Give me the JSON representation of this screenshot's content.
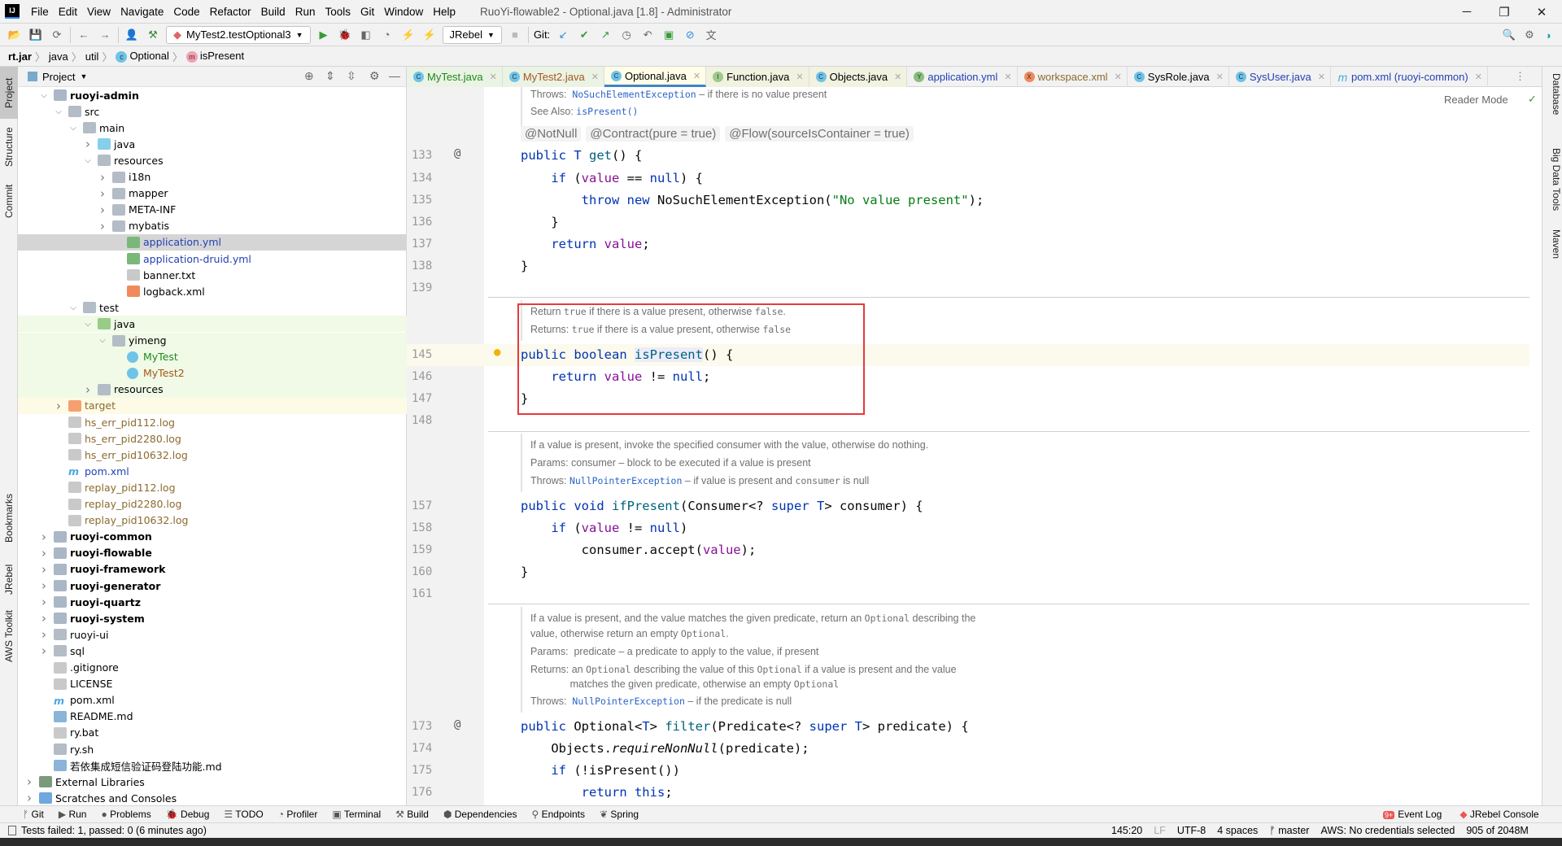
{
  "window": {
    "title": "RuoYi-flowable2 - Optional.java [1.8] - Administrator",
    "logo": "IJ"
  },
  "menu": [
    "File",
    "Edit",
    "View",
    "Navigate",
    "Code",
    "Refactor",
    "Build",
    "Run",
    "Tools",
    "Git",
    "Window",
    "Help"
  ],
  "toolbar": {
    "run_config": "MyTest2.testOptional3",
    "jrebel": "JRebel",
    "git_label": "Git:"
  },
  "breadcrumb": [
    "rt.jar",
    "java",
    "util",
    "Optional",
    "isPresent"
  ],
  "left_stripe": [
    "Project",
    "Structure",
    "Commit",
    "Bookmarks",
    "JRebel",
    "AWS Toolkit"
  ],
  "right_stripe": [
    "Database",
    "Big Data Tools",
    "Maven"
  ],
  "project": {
    "title": "Project",
    "tree": [
      {
        "label": "ruoyi-admin",
        "depth": 0,
        "arrow": "open",
        "icon": "module",
        "bold": true
      },
      {
        "label": "src",
        "depth": 1,
        "arrow": "open",
        "icon": "folder"
      },
      {
        "label": "main",
        "depth": 2,
        "arrow": "open",
        "icon": "folder"
      },
      {
        "label": "java",
        "depth": 3,
        "arrow": "closed",
        "icon": "src-folder"
      },
      {
        "label": "resources",
        "depth": 3,
        "arrow": "open",
        "icon": "res-folder"
      },
      {
        "label": "i18n",
        "depth": 4,
        "arrow": "closed",
        "icon": "folder"
      },
      {
        "label": "mapper",
        "depth": 4,
        "arrow": "closed",
        "icon": "folder"
      },
      {
        "label": "META-INF",
        "depth": 4,
        "arrow": "closed",
        "icon": "folder"
      },
      {
        "label": "mybatis",
        "depth": 4,
        "arrow": "closed",
        "icon": "folder"
      },
      {
        "label": "application.yml",
        "depth": 5,
        "icon": "yml",
        "color": "#2341b4",
        "bg": "#d5d5d5"
      },
      {
        "label": "application-druid.yml",
        "depth": 5,
        "icon": "yml",
        "color": "#2341b4"
      },
      {
        "label": "banner.txt",
        "depth": 5,
        "icon": "file"
      },
      {
        "label": "logback.xml",
        "depth": 5,
        "icon": "xml"
      },
      {
        "label": "test",
        "depth": 2,
        "arrow": "open",
        "icon": "folder"
      },
      {
        "label": "java",
        "depth": 3,
        "arrow": "open",
        "icon": "test-folder",
        "bg": "#f0fae6"
      },
      {
        "label": "yimeng",
        "depth": 4,
        "arrow": "open",
        "icon": "package",
        "bg": "#f0fae6"
      },
      {
        "label": "MyTest",
        "depth": 5,
        "icon": "class",
        "color": "#20891f",
        "bg": "#f0fae6"
      },
      {
        "label": "MyTest2",
        "depth": 5,
        "icon": "class",
        "color": "#a5571a",
        "bg": "#f0fae6"
      },
      {
        "label": "resources",
        "depth": 3,
        "arrow": "closed",
        "icon": "res-folder",
        "bg": "#f0fae6"
      },
      {
        "label": "target",
        "depth": 1,
        "arrow": "closed",
        "icon": "excluded",
        "color": "#8c6a2e",
        "bg": "#fdfbe6"
      },
      {
        "label": "hs_err_pid112.log",
        "depth": 1,
        "icon": "file",
        "color": "#8c6a2e"
      },
      {
        "label": "hs_err_pid2280.log",
        "depth": 1,
        "icon": "file",
        "color": "#8c6a2e"
      },
      {
        "label": "hs_err_pid10632.log",
        "depth": 1,
        "icon": "file",
        "color": "#8c6a2e"
      },
      {
        "label": "pom.xml",
        "depth": 1,
        "icon": "maven",
        "color": "#2341b4"
      },
      {
        "label": "replay_pid112.log",
        "depth": 1,
        "icon": "file",
        "color": "#8c6a2e"
      },
      {
        "label": "replay_pid2280.log",
        "depth": 1,
        "icon": "file",
        "color": "#8c6a2e"
      },
      {
        "label": "replay_pid10632.log",
        "depth": 1,
        "icon": "file",
        "color": "#8c6a2e"
      },
      {
        "label": "ruoyi-common",
        "depth": 0,
        "arrow": "closed",
        "icon": "module",
        "bold": true
      },
      {
        "label": "ruoyi-flowable",
        "depth": 0,
        "arrow": "closed",
        "icon": "module",
        "bold": true
      },
      {
        "label": "ruoyi-framework",
        "depth": 0,
        "arrow": "closed",
        "icon": "module",
        "bold": true
      },
      {
        "label": "ruoyi-generator",
        "depth": 0,
        "arrow": "closed",
        "icon": "module",
        "bold": true
      },
      {
        "label": "ruoyi-quartz",
        "depth": 0,
        "arrow": "closed",
        "icon": "module",
        "bold": true
      },
      {
        "label": "ruoyi-system",
        "depth": 0,
        "arrow": "closed",
        "icon": "module",
        "bold": true
      },
      {
        "label": "ruoyi-ui",
        "depth": 0,
        "arrow": "closed",
        "icon": "folder"
      },
      {
        "label": "sql",
        "depth": 0,
        "arrow": "closed",
        "icon": "folder"
      },
      {
        "label": ".gitignore",
        "depth": 0,
        "icon": "file"
      },
      {
        "label": "LICENSE",
        "depth": 0,
        "icon": "file"
      },
      {
        "label": "pom.xml",
        "depth": 0,
        "icon": "maven"
      },
      {
        "label": "README.md",
        "depth": 0,
        "icon": "md"
      },
      {
        "label": "ry.bat",
        "depth": 0,
        "icon": "file"
      },
      {
        "label": "ry.sh",
        "depth": 0,
        "icon": "shell"
      },
      {
        "label": "若依集成短信验证码登陆功能.md",
        "depth": 0,
        "icon": "md"
      },
      {
        "label": "External Libraries",
        "depth": -1,
        "arrow": "closed",
        "icon": "libs"
      },
      {
        "label": "Scratches and Consoles",
        "depth": -1,
        "arrow": "closed",
        "icon": "scratch"
      }
    ]
  },
  "tabs": [
    {
      "label": "MyTest.java",
      "color": "#20891f",
      "icon": "C",
      "bg": "#eaf3e4"
    },
    {
      "label": "MyTest2.java",
      "color": "#a5571a",
      "icon": "C",
      "bg": "#eaf3e4"
    },
    {
      "label": "Optional.java",
      "color": "#000000",
      "icon": "C",
      "active": true
    },
    {
      "label": "Function.java",
      "color": "#000000",
      "icon": "I",
      "bg": "#f2f2e0"
    },
    {
      "label": "Objects.java",
      "color": "#000000",
      "icon": "C",
      "bg": "#f2f2e0"
    },
    {
      "label": "application.yml",
      "color": "#2341b4",
      "icon": "Y"
    },
    {
      "label": "workspace.xml",
      "color": "#8c6a2e",
      "icon": "X"
    },
    {
      "label": "SysRole.java",
      "color": "#000000",
      "icon": "C"
    },
    {
      "label": "SysUser.java",
      "color": "#2341b4",
      "icon": "C"
    },
    {
      "label": "pom.xml (ruoyi-common)",
      "color": "#2341b4",
      "icon": "m"
    }
  ],
  "editor": {
    "reader_mode": "Reader Mode",
    "annotations": [
      "@NotNull",
      "@Contract(pure = true)",
      "@Flow(sourceIsContainer = true)"
    ],
    "docs": [
      {
        "lines": [
          [
            [
              "Throws:  ",
              ""
            ],
            [
              "NoSuchElementException",
              "lnk"
            ],
            [
              " – if there is no value present",
              ""
            ]
          ],
          [
            [
              "See Also: ",
              ""
            ],
            [
              "isPresent()",
              "lnk"
            ]
          ]
        ],
        "start": 0
      },
      {
        "lines": [
          [
            [
              "Return ",
              ""
            ],
            [
              "true",
              "m"
            ],
            [
              " if there is a value present, otherwise ",
              ""
            ],
            [
              "false",
              "m"
            ],
            [
              ".",
              ""
            ]
          ],
          [
            [
              "Returns: ",
              ""
            ],
            [
              "true",
              "m"
            ],
            [
              " if there is a value present, otherwise ",
              ""
            ],
            [
              "false",
              "m"
            ]
          ]
        ]
      },
      {
        "lines": [
          [
            [
              "If a value is present, invoke the specified consumer with the value, otherwise do nothing.",
              ""
            ]
          ],
          [
            [
              "Params: consumer – block to be executed if a value is present",
              ""
            ]
          ],
          [
            [
              "Throws: ",
              ""
            ],
            [
              "NullPointerException",
              "lnk"
            ],
            [
              " – if value is present and ",
              ""
            ],
            [
              "consumer",
              "m"
            ],
            [
              " is null",
              ""
            ]
          ]
        ]
      },
      {
        "lines": [
          [
            [
              "If a value is present, and the value matches the given predicate, return an ",
              ""
            ],
            [
              "Optional",
              "m"
            ],
            [
              " describing the",
              ""
            ]
          ],
          [
            [
              "value, otherwise return an empty ",
              ""
            ],
            [
              "Optional",
              "m"
            ],
            [
              ".",
              ""
            ]
          ],
          [
            [
              "Params:  predicate – a predicate to apply to the value, if present",
              ""
            ]
          ],
          [
            [
              "Returns: an ",
              ""
            ],
            [
              "Optional",
              "m"
            ],
            [
              " describing the value of this ",
              ""
            ],
            [
              "Optional",
              "m"
            ],
            [
              " if a value is present and the value",
              ""
            ]
          ],
          [
            [
              "              matches the given predicate, otherwise an empty ",
              ""
            ],
            [
              "Optional",
              "m"
            ]
          ],
          [
            [
              "Throws:  ",
              ""
            ],
            [
              "NullPointerException",
              "lnk"
            ],
            [
              " – if the predicate is null",
              ""
            ]
          ]
        ]
      }
    ],
    "lines": [
      {
        "n": "133",
        "mark": "@",
        "t": [
          [
            "public ",
            "kw"
          ],
          [
            "T ",
            "kw"
          ],
          [
            "get",
            "fn"
          ],
          [
            "() {",
            ""
          ]
        ]
      },
      {
        "n": "134",
        "t": [
          [
            "    if ",
            "kw"
          ],
          [
            "(",
            ""
          ],
          [
            "value",
            "fd"
          ],
          [
            " == ",
            ""
          ],
          [
            "null",
            "kw"
          ],
          [
            ") {",
            ""
          ]
        ]
      },
      {
        "n": "135",
        "t": [
          [
            "        throw new ",
            "kw"
          ],
          [
            "NoSuchElementException(",
            ""
          ],
          [
            "\"No value present\"",
            "st"
          ],
          [
            ");",
            ""
          ]
        ]
      },
      {
        "n": "136",
        "t": [
          [
            "    }",
            ""
          ]
        ]
      },
      {
        "n": "137",
        "t": [
          [
            "    return ",
            "kw"
          ],
          [
            "value",
            "fd"
          ],
          [
            ";",
            ""
          ]
        ]
      },
      {
        "n": "138",
        "t": [
          [
            "}",
            ""
          ]
        ]
      },
      {
        "n": "139",
        "t": []
      },
      {
        "n": "145",
        "mark": "bulb",
        "t": [
          [
            "public boolean ",
            "kw"
          ],
          [
            "isPresent",
            "fn"
          ],
          [
            "() {",
            ""
          ]
        ]
      },
      {
        "n": "146",
        "t": [
          [
            "    return ",
            "kw"
          ],
          [
            "value",
            "fd"
          ],
          [
            " != ",
            ""
          ],
          [
            "null",
            "kw"
          ],
          [
            ";",
            ""
          ]
        ]
      },
      {
        "n": "147",
        "t": [
          [
            "}",
            ""
          ]
        ]
      },
      {
        "n": "148",
        "t": []
      },
      {
        "n": "157",
        "t": [
          [
            "public void ",
            "kw"
          ],
          [
            "ifPresent",
            "fn"
          ],
          [
            "(Consumer<? ",
            ""
          ],
          [
            "super ",
            "kw"
          ],
          [
            "T",
            "kw"
          ],
          [
            "> consumer) {",
            ""
          ]
        ]
      },
      {
        "n": "158",
        "t": [
          [
            "    if ",
            "kw"
          ],
          [
            "(",
            ""
          ],
          [
            "value",
            "fd"
          ],
          [
            " != ",
            ""
          ],
          [
            "null",
            "kw"
          ],
          [
            ")",
            ""
          ]
        ]
      },
      {
        "n": "159",
        "t": [
          [
            "        consumer.accept(",
            ""
          ],
          [
            "value",
            "fd"
          ],
          [
            ");",
            ""
          ]
        ]
      },
      {
        "n": "160",
        "t": [
          [
            "}",
            ""
          ]
        ]
      },
      {
        "n": "161",
        "t": []
      },
      {
        "n": "173",
        "mark": "@",
        "t": [
          [
            "public ",
            "kw"
          ],
          [
            "Optional<",
            ""
          ],
          [
            "T",
            "kw"
          ],
          [
            "> ",
            ""
          ],
          [
            "filter",
            "fn"
          ],
          [
            "(Predicate<? ",
            ""
          ],
          [
            "super ",
            "kw"
          ],
          [
            "T",
            "kw"
          ],
          [
            "> predicate) {",
            ""
          ]
        ]
      },
      {
        "n": "174",
        "t": [
          [
            "    Objects.",
            ""
          ],
          [
            "requireNonNull",
            "it"
          ],
          [
            "(predicate);",
            ""
          ]
        ]
      },
      {
        "n": "175",
        "t": [
          [
            "    if ",
            "kw"
          ],
          [
            "(!isPresent())",
            ""
          ]
        ]
      },
      {
        "n": "176",
        "t": [
          [
            "        return this",
            "kw"
          ],
          [
            ";",
            ""
          ]
        ]
      }
    ]
  },
  "bottom_tools": [
    "Git",
    "Run",
    "Problems",
    "Debug",
    "TODO",
    "Profiler",
    "Terminal",
    "Build",
    "Dependencies",
    "Endpoints",
    "Spring"
  ],
  "bottom_right": {
    "event_log": "Event Log",
    "event_badge": "9+",
    "jrebel_console": "JRebel Console"
  },
  "status": {
    "message": "Tests failed: 1, passed: 0 (6 minutes ago)",
    "position": "145:20",
    "line_sep": "LF",
    "encoding": "UTF-8",
    "indent": "4 spaces",
    "branch": "master",
    "aws": "AWS: No credentials selected",
    "memory": "905 of 2048M"
  },
  "colors": {
    "highlight_box": "#e8383d",
    "keyword": "#0033b3",
    "active_tab": "#4083c9"
  }
}
